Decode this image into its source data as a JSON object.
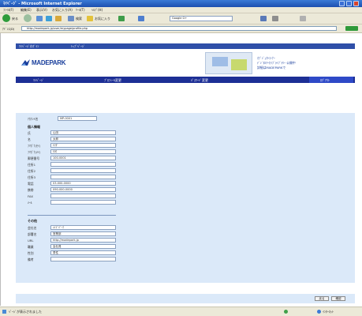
{
  "window": {
    "title": "ﾏｲﾍﾟｰｼﾞ - Microsoft Internet Explorer"
  },
  "menu": {
    "items": [
      "ﾌｧｲﾙ(F)",
      "編集(E)",
      "表示(V)",
      "お気に入り(A)",
      "ﾂｰﾙ(T)",
      "ﾍﾙﾌﾟ(H)"
    ]
  },
  "toolbar": {
    "back_label": "戻る",
    "search_label": "検索",
    "favorites_label": "お気に入り",
    "search_box": "Google G+"
  },
  "address": {
    "label": "ｱﾄﾞﾚｽ(D)",
    "url": "http://madepark.jp/user/mypage/profile.php",
    "go_label": "移動"
  },
  "site": {
    "breadcrumb": [
      "ﾏｲﾍﾟｰｼﾞ/ﾛｸﾞｲﾝ",
      "ﾄｯﾌﾟﾍﾟｰｼﾞ"
    ],
    "logo_text": "MADEPARK",
    "banner_lines": [
      "ｵﾌﾞｼﾞｪｸﾄｺｰﾅｰ",
      "ﾃﾞｼﾞﾀﾙｱｰｶｲﾌﾞﾗｲﾌﾞﾗﾘｰ 公開中",
      "詳細はMADEPARKで"
    ],
    "nav": [
      "ﾏｲﾍﾟｰｼﾞ",
      "ﾌﾟﾛﾌｨｰﾙ変更",
      "ﾊﾟｽﾜｰﾄﾞ変更",
      "ﾛｸﾞｱｳﾄ"
    ]
  },
  "form": {
    "account_label": "ｱｶｳﾝﾄ名",
    "account_value": "MP-0001",
    "section_basic": "個人情報",
    "fields": [
      {
        "label": "氏",
        "value": "山田"
      },
      {
        "label": "名",
        "value": "太郎"
      },
      {
        "label": "ﾌﾘｶﾞﾅ(ｾｲ)",
        "value": "ﾔﾏﾀﾞ"
      },
      {
        "label": "ﾌﾘｶﾞﾅ(ﾒｲ)",
        "value": "ﾀﾛｳ"
      },
      {
        "label": "郵便番号",
        "value": "100-0001"
      },
      {
        "label": "住所1",
        "value": ""
      },
      {
        "label": "住所2",
        "value": ""
      },
      {
        "label": "住所3",
        "value": ""
      },
      {
        "label": "電話",
        "value": "03-000-0000"
      },
      {
        "label": "携帯",
        "value": "090-000-0000"
      },
      {
        "label": "FAX",
        "value": ""
      },
      {
        "label": "ﾒｰﾙ",
        "value": ""
      }
    ],
    "section_other": "その他",
    "other_fields": [
      {
        "label": "会社名",
        "value": "ﾒｲﾄﾞﾊﾟｰｸ"
      },
      {
        "label": "部署名",
        "value": "営業部"
      },
      {
        "label": "URL",
        "value": "http://madepark.jp"
      },
      {
        "label": "職業",
        "value": "会社員"
      },
      {
        "label": "性別",
        "value": "男性"
      },
      {
        "label": "備考",
        "value": ""
      }
    ],
    "buttons": {
      "back": "戻る",
      "submit": "確認"
    }
  },
  "status": {
    "text": "ﾍﾟｰｼﾞが表示されました",
    "zone": "ｲﾝﾀｰﾈｯﾄ"
  }
}
